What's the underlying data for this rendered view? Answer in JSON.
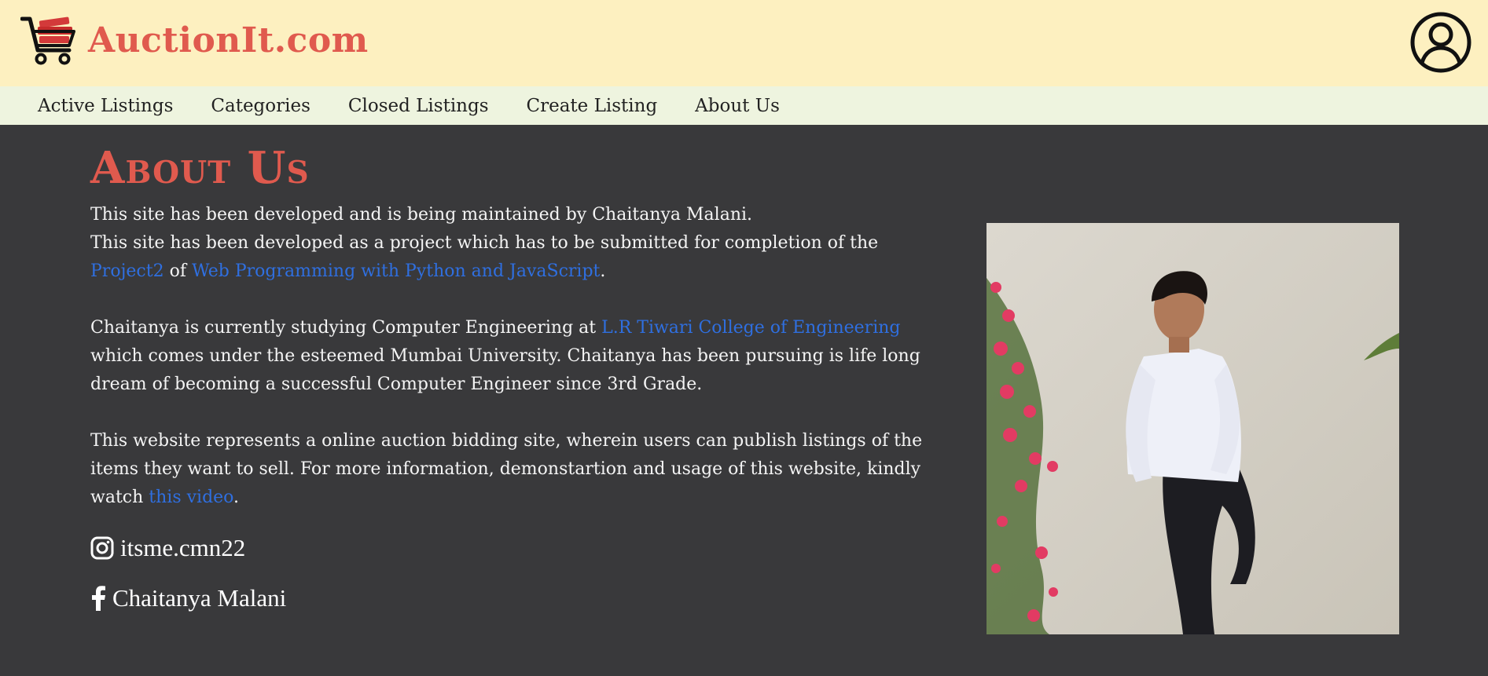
{
  "header": {
    "brand_name": "AuctionIt.com",
    "logo_icon": "shopping-cart-icon",
    "profile_icon": "user-circle-icon"
  },
  "nav": {
    "items": [
      {
        "label": "Active Listings"
      },
      {
        "label": "Categories"
      },
      {
        "label": "Closed Listings"
      },
      {
        "label": "Create Listing"
      },
      {
        "label": "About Us"
      }
    ]
  },
  "about": {
    "title": "About Us",
    "p1_line1": "This site has been developed and is being maintained by Chaitanya Malani.",
    "p1_line2_a": "This site has been developed as a project which has to be submitted for completion of the ",
    "p1_link_project": "Project2",
    "p1_line2_b": " of ",
    "p1_link_course": "Web Programming with Python and JavaScript",
    "p1_end": ".",
    "p2_a": "Chaitanya is currently studying Computer Engineering at ",
    "p2_link_college": "L.R Tiwari College of Engineering",
    "p2_b": " which comes under the esteemed Mumbai University. Chaitanya has been pursuing is life long dream of becoming a successful Computer Engineer since 3rd Grade.",
    "p3_a": "This website represents a online auction bidding site, wherein users can publish listings of the items they want to sell. For more information, demonstartion and usage of this website, kindly watch ",
    "p3_link_video": "this video",
    "p3_end": ".",
    "instagram_handle": "itsme.cmn22",
    "facebook_name": "Chaitanya Malani"
  },
  "colors": {
    "header_bg": "#fdf0c0",
    "nav_bg": "#eef4df",
    "page_bg": "#39393b",
    "accent": "#e05a4e",
    "link": "#2f6fe0"
  }
}
